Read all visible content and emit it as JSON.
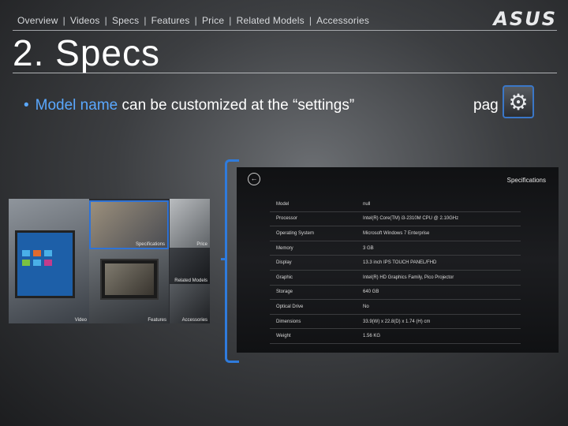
{
  "nav": {
    "items": [
      "Overview",
      "Videos",
      "Specs",
      "Features",
      "Price",
      "Related Models",
      "Accessories"
    ],
    "separator": "|"
  },
  "logo": "ASUS",
  "title": "2. Specs",
  "bullet": {
    "highlight": "Model name",
    "text": " can be customized at the “settings”",
    "tail": "pag"
  },
  "gear_icon": "gear-icon",
  "collage": {
    "tiles": {
      "specifications": "Specifications",
      "price": "Price",
      "related": "Related Models",
      "features": "Features",
      "video": "Video",
      "accessories": "Accessories"
    }
  },
  "screen": {
    "back_icon": "back-arrow-icon",
    "title": "Specifications",
    "rows": [
      {
        "key": "Model",
        "value": "null"
      },
      {
        "key": "Processor",
        "value": "Intel(R) Core(TM) i3-2310M CPU @ 2.10GHz"
      },
      {
        "key": "Operating System",
        "value": "Microsoft Windows 7 Enterprise"
      },
      {
        "key": "Memory",
        "value": "3 GB"
      },
      {
        "key": "Display",
        "value": "13.3 inch IPS TOUCH PANEL/FHD"
      },
      {
        "key": "Graphic",
        "value": "Intel(R) HD Graphics Family, Pico Projector"
      },
      {
        "key": "Storage",
        "value": "640 GB"
      },
      {
        "key": "Optical Drive",
        "value": "No"
      },
      {
        "key": "Dimensions",
        "value": "33.9(W) x 22.8(D) x 1.74 (H) cm"
      },
      {
        "key": "Weight",
        "value": "1.56 KG"
      }
    ]
  },
  "colors": {
    "accent": "#2f7bdc",
    "highlight": "#5aa8ff"
  }
}
